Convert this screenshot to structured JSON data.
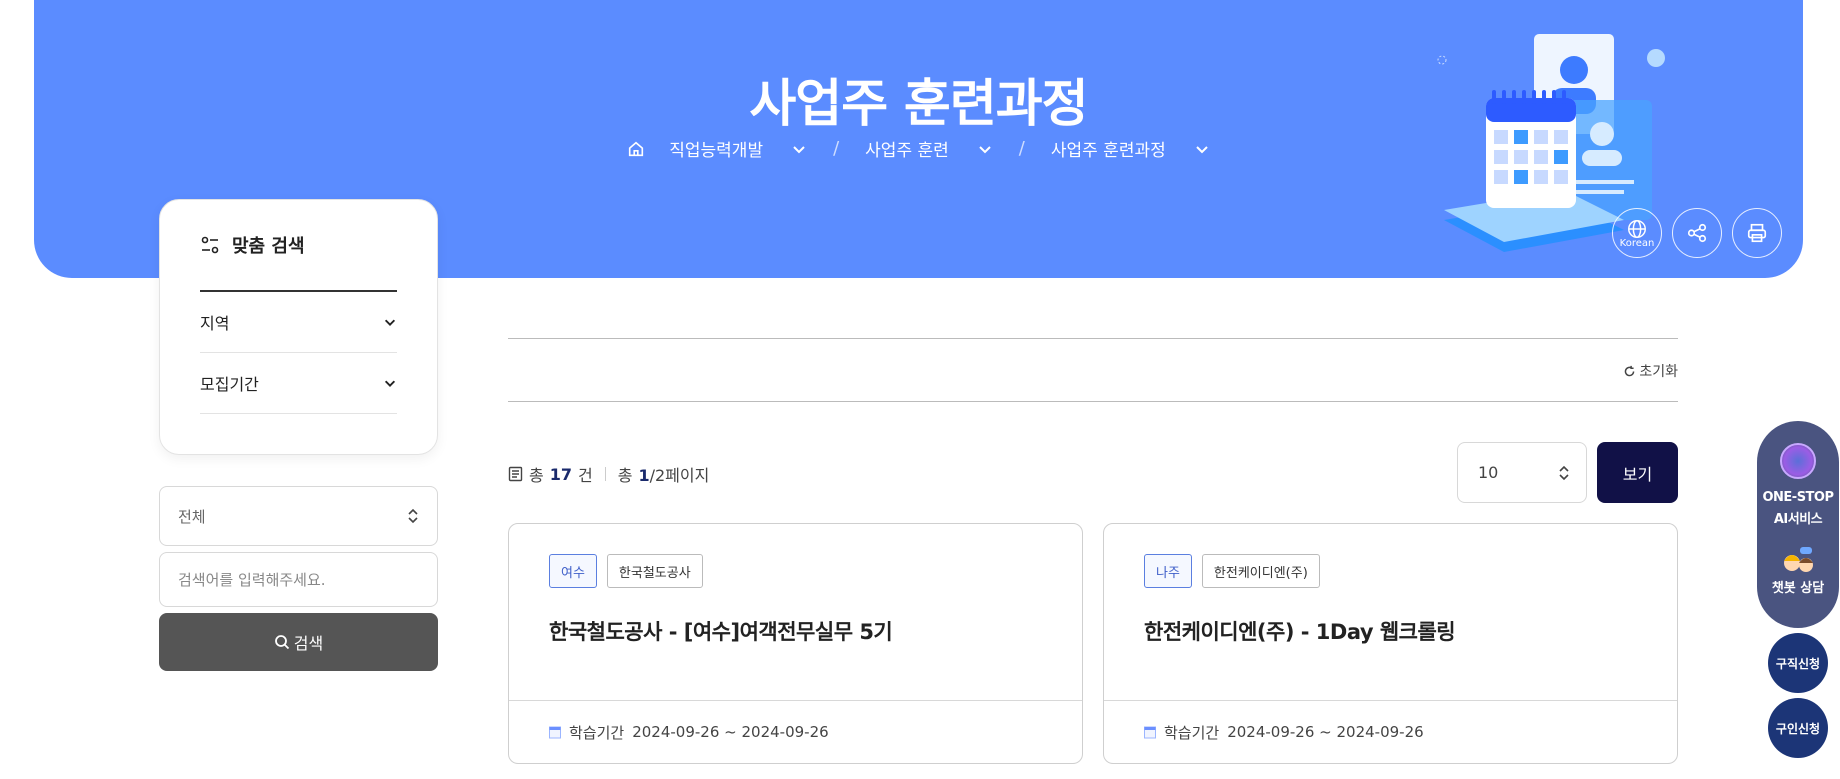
{
  "banner": {
    "title": "사업주 훈련과정",
    "breadcrumb": [
      "직업능력개발",
      "사업주 훈련",
      "사업주 훈련과정"
    ],
    "tools": {
      "language_label": "Korean"
    }
  },
  "filter": {
    "heading": "맞춤 검색",
    "rows": [
      "지역",
      "모집기간"
    ]
  },
  "search": {
    "select_value": "전체",
    "input_placeholder": "검색어를 입력해주세요.",
    "button_label": "검색"
  },
  "main": {
    "reset_label": "초기화",
    "count": {
      "prefix": "총",
      "total": "17",
      "unit": "건",
      "page_prefix": "총",
      "page_current": "1",
      "page_suffix": "/2페이지"
    },
    "per_page_value": "10",
    "view_button": "보기",
    "cards": [
      {
        "region": "여수",
        "org": "한국철도공사",
        "title": "한국철도공사 - [여수]여객전무실무 5기",
        "period_label": "학습기간",
        "period": "2024-09-26 ~ 2024-09-26"
      },
      {
        "region": "나주",
        "org": "한전케이디엔(주)",
        "title": "한전케이디엔(주) - 1Day 웹크롤링",
        "period_label": "학습기간",
        "period": "2024-09-26 ~ 2024-09-26"
      }
    ]
  },
  "floating": {
    "ai_line1": "ONE-STOP",
    "ai_line2": "AI서비스",
    "chat": "챗봇 상담",
    "job_seek": "구직신청",
    "job_offer": "구인신청"
  },
  "colors": {
    "banner": "#5b8cff",
    "view_button": "#111147",
    "search_button": "#555555",
    "float_bg": "#4a5480",
    "round_btn": "#1c3577"
  }
}
